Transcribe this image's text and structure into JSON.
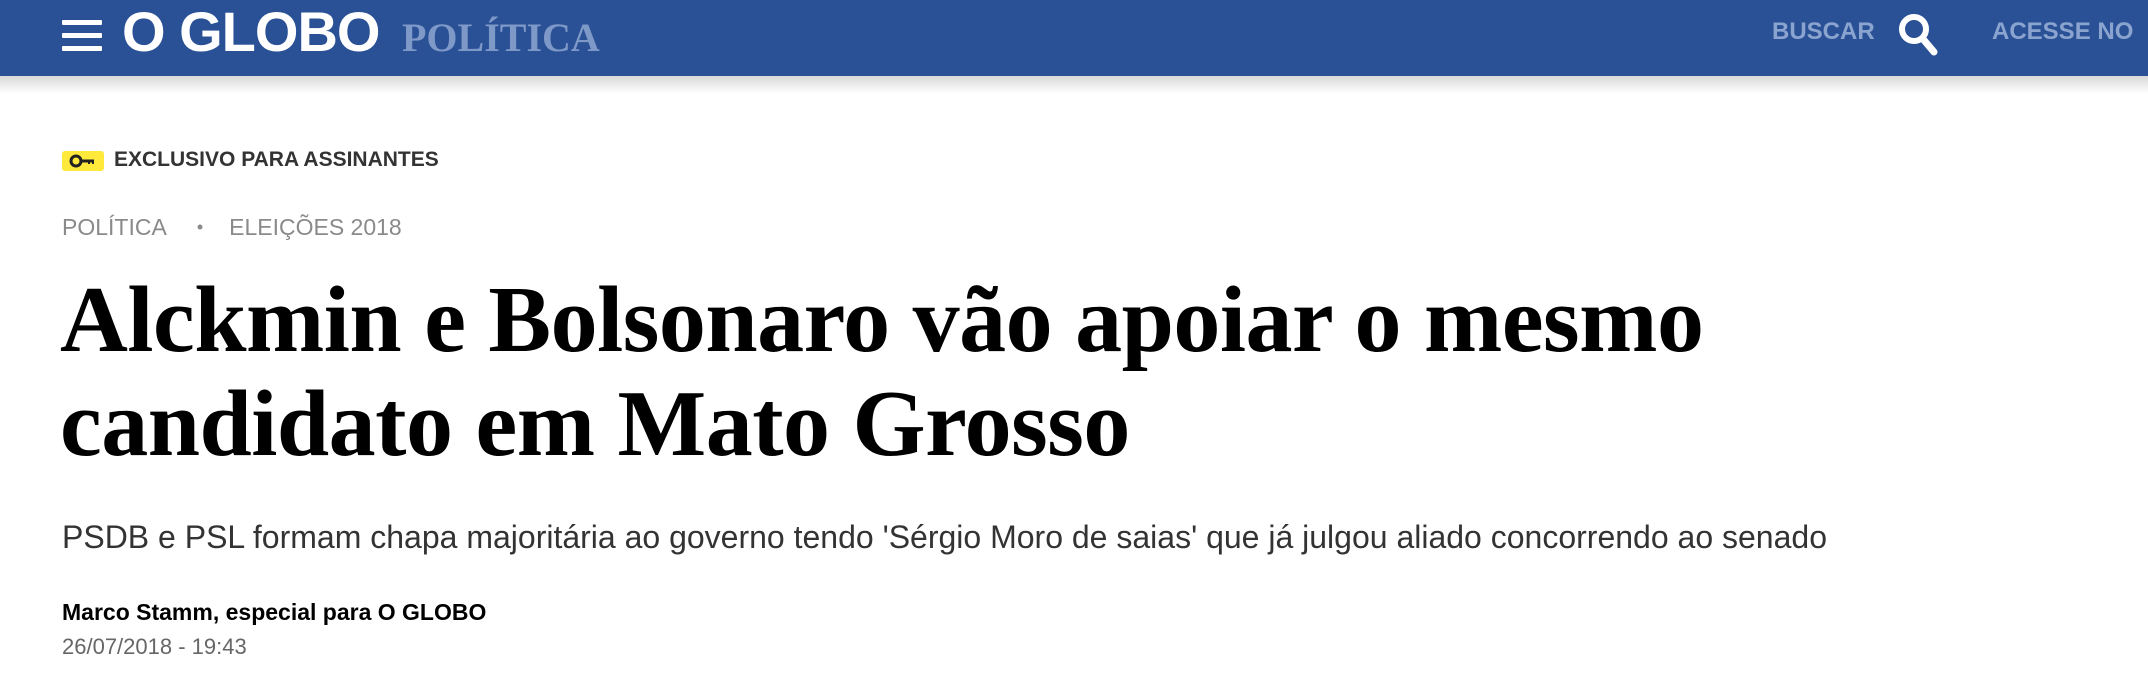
{
  "header": {
    "logo_text": "O GLOBO",
    "section_title": "POLÍTICA",
    "search_label": "BUSCAR",
    "access_label": "ACESSE NO",
    "bar_color": "#2a5196",
    "icons": [
      "menu-icon",
      "search-icon"
    ]
  },
  "article": {
    "exclusive_label": "EXCLUSIVO PARA ASSINANTES",
    "exclusive_icon": "key-icon",
    "exclusive_badge_color": "#ffea3c",
    "breadcrumb": [
      "POLÍTICA",
      "ELEIÇÕES 2018"
    ],
    "headline_line1": "Alckmin e Bolsonaro vão apoiar o mesmo",
    "headline_line2": "candidato em Mato Grosso",
    "subtitle": "PSDB e PSL formam chapa majoritária ao governo tendo 'Sérgio Moro de saias' que já julgou aliado concorrendo ao senado",
    "author": "Marco Stamm, especial para O GLOBO",
    "datetime": "26/07/2018 - 19:43"
  }
}
